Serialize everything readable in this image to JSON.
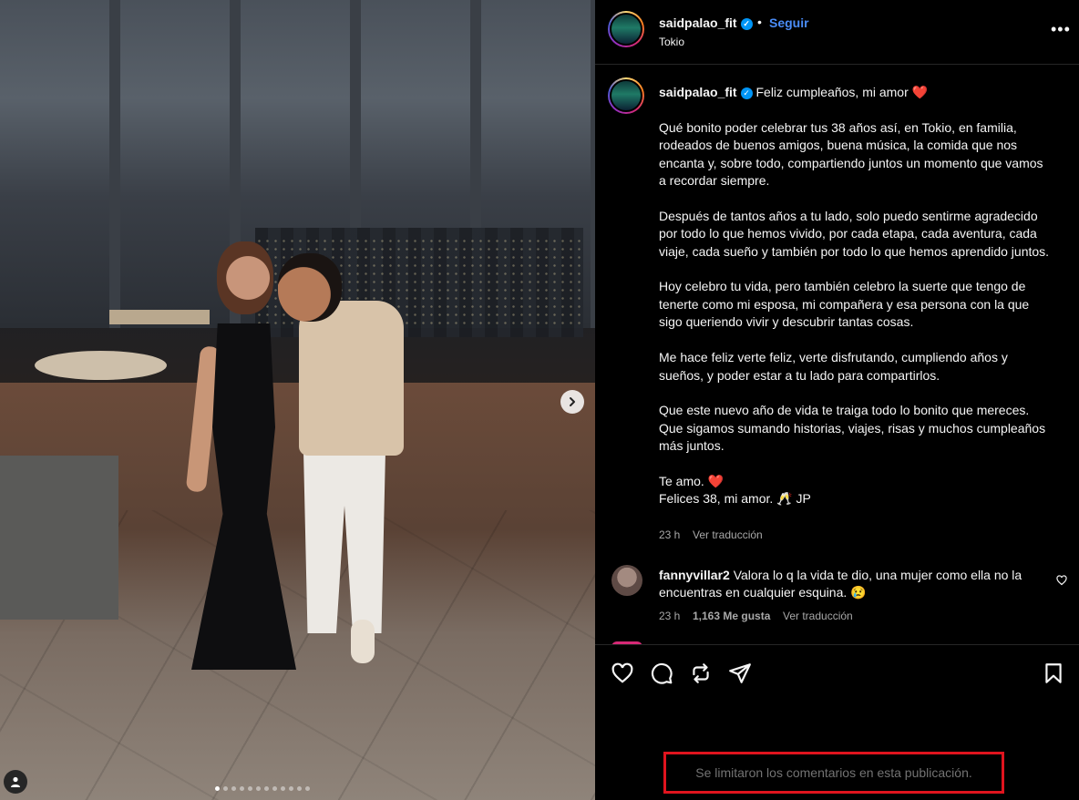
{
  "post": {
    "username": "saidpalao_fit",
    "follow_label": "Seguir",
    "separator": "•",
    "location": "Tokio",
    "more_label": "•••"
  },
  "caption": {
    "username": "saidpalao_fit",
    "text": "Feliz cumpleaños, mi amor ❤️\n\nQué bonito poder celebrar tus 38 años así, en Tokio, en familia, rodeados de buenos amigos, buena música, la comida que nos encanta y, sobre todo, compartiendo juntos un momento que vamos a recordar siempre.\n\nDespués de tantos años a tu lado, solo puedo sentirme agradecido por todo lo que hemos vivido, por cada etapa, cada aventura, cada viaje, cada sueño y también por todo lo que hemos aprendido juntos.\n\nHoy celebro tu vida, pero también celebro la suerte que tengo de tenerte como mi esposa, mi compañera y esa persona con la que sigo queriendo vivir y descubrir tantas cosas.\n\nMe hace feliz verte feliz, verte disfrutando, cumpliendo años y sueños, y poder estar a tu lado para compartirlos.\n\nQue este nuevo año de vida te traiga todo lo bonito que mereces. Que sigamos sumando historias, viajes, risas y muchos cumpleaños más juntos.\n\nTe amo. ❤️\nFelices 38, mi amor. 🥂 JP",
    "time": "23 h",
    "translate": "Ver traducción"
  },
  "comment": {
    "username": "fannyvillar2",
    "text": "Valora lo q la vida te dio, una mujer como ella no la encuentras en cualquier esquina. 😢",
    "time": "23 h",
    "likes": "1,163 Me gusta",
    "translate": "Ver traducción"
  },
  "footer": {
    "comments_limited": "Se limitaron los comentarios en esta publicación."
  },
  "carousel": {
    "slides": 12,
    "active_index": 0
  },
  "icons": [
    "verified-icon",
    "more-icon",
    "heart-icon",
    "comment-icon",
    "repost-icon",
    "share-icon",
    "bookmark-icon",
    "next-arrow-icon",
    "user-tag-icon"
  ],
  "colors": {
    "accent": "#4a8df8",
    "verified": "#0095f6",
    "highlight_border": "#e0141e",
    "background": "#000000"
  }
}
